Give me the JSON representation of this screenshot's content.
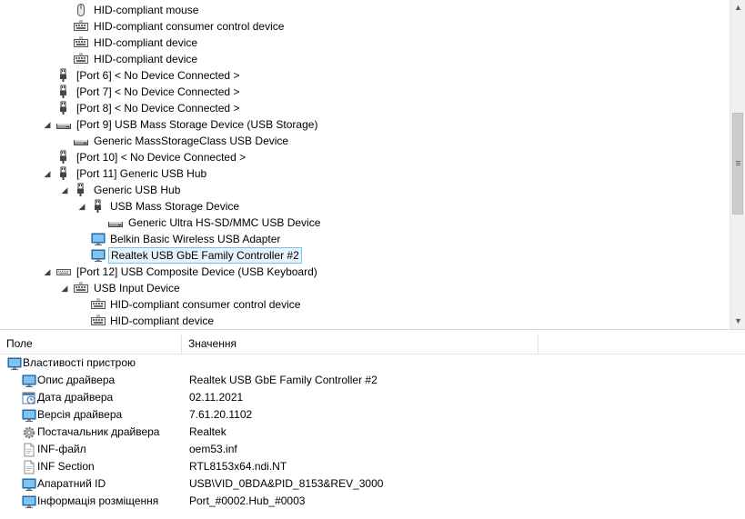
{
  "tree": {
    "rows": [
      {
        "label": "HID-compliant mouse",
        "icon": "mouse-icon",
        "exp": ""
      },
      {
        "label": "HID-compliant consumer control device",
        "icon": "keyboard-icon",
        "exp": ""
      },
      {
        "label": "HID-compliant device",
        "icon": "keyboard-icon",
        "exp": ""
      },
      {
        "label": "HID-compliant device",
        "icon": "keyboard-icon",
        "exp": ""
      },
      {
        "label": "[Port 6] < No Device Connected >",
        "icon": "usb-plug-icon",
        "exp": ""
      },
      {
        "label": "[Port 7] < No Device Connected >",
        "icon": "usb-plug-icon",
        "exp": ""
      },
      {
        "label": "[Port 8] < No Device Connected >",
        "icon": "usb-plug-icon",
        "exp": ""
      },
      {
        "label": "[Port 9] USB Mass Storage Device (USB Storage)",
        "icon": "drive-icon",
        "exp": "◢"
      },
      {
        "label": "Generic MassStorageClass USB Device",
        "icon": "drive-icon",
        "exp": ""
      },
      {
        "label": "[Port 10] < No Device Connected >",
        "icon": "usb-plug-icon",
        "exp": ""
      },
      {
        "label": "[Port 11] Generic USB Hub",
        "icon": "usb-plug-icon",
        "exp": "◢"
      },
      {
        "label": "Generic USB Hub",
        "icon": "usb-plug-icon",
        "exp": "◢"
      },
      {
        "label": "USB Mass Storage Device",
        "icon": "usb-plug-icon",
        "exp": "◢"
      },
      {
        "label": "Generic Ultra HS-SD/MMC USB Device",
        "icon": "drive-icon",
        "exp": ""
      },
      {
        "label": "Belkin Basic Wireless USB Adapter",
        "icon": "monitor-icon",
        "exp": ""
      },
      {
        "label": "Realtek USB GbE Family Controller #2",
        "icon": "monitor-icon",
        "exp": "",
        "selected": true
      },
      {
        "label": "[Port 12] USB Composite Device (USB Keyboard)",
        "icon": "keyboard-flat-icon",
        "exp": "◢"
      },
      {
        "label": "USB Input Device",
        "icon": "keyboard-icon",
        "exp": "◢"
      },
      {
        "label": "HID-compliant consumer control device",
        "icon": "keyboard-icon",
        "exp": ""
      },
      {
        "label": "HID-compliant device",
        "icon": "keyboard-icon",
        "exp": ""
      }
    ]
  },
  "scrollbar": {
    "up": "▲",
    "down": "▼"
  },
  "props": {
    "col_field": "Поле",
    "col_value": "Значення",
    "group_label": "Властивості пристрою",
    "rows": [
      {
        "name": "Опис драйвера",
        "value": "Realtek USB GbE Family Controller #2",
        "icon": "monitor-icon"
      },
      {
        "name": "Дата драйвера",
        "value": "02.11.2021",
        "icon": "calendar-icon"
      },
      {
        "name": "Версія драйвера",
        "value": "7.61.20.1102",
        "icon": "monitor-icon"
      },
      {
        "name": "Постачальник драйвера",
        "value": "Realtek",
        "icon": "gear-icon"
      },
      {
        "name": "INF-файл",
        "value": "oem53.inf",
        "icon": "document-icon"
      },
      {
        "name": "INF Section",
        "value": "RTL8153x64.ndi.NT",
        "icon": "document-icon"
      },
      {
        "name": "Апаратний ID",
        "value": "USB\\VID_0BDA&PID_8153&REV_3000",
        "icon": "monitor-icon"
      },
      {
        "name": "Інформація розміщення",
        "value": "Port_#0002.Hub_#0003",
        "icon": "monitor-icon"
      }
    ]
  }
}
